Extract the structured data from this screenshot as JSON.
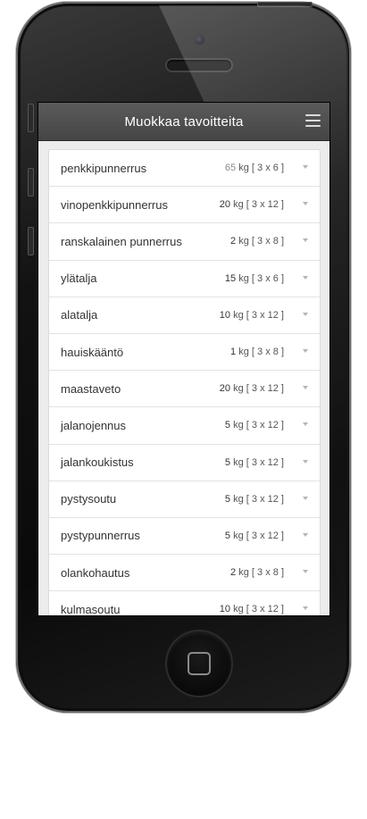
{
  "app": {
    "title": "Muokkaa tavoitteita"
  },
  "icons": {
    "menu": "hamburger-menu-icon",
    "row_arrow": "chevron-down-icon",
    "home": "home-button-square"
  },
  "colors": {
    "navbar": "#4f4f4f",
    "navbar_text": "#ffffff",
    "screen_bg": "#ececec",
    "list_bg": "#ffffff",
    "row_text": "#333333",
    "chevron": "#b5b5b5",
    "phone_body": "#0f0f0f"
  },
  "goals": [
    {
      "name": "penkkipunnerrus",
      "weight": "65",
      "unit": "kg",
      "sets": "[ 3 x 6 ]"
    },
    {
      "name": "vinopenkkipunnerrus",
      "weight": "20",
      "unit": "kg",
      "sets": "[ 3 x 12 ]"
    },
    {
      "name": "ranskalainen punnerrus",
      "weight": "2",
      "unit": "kg",
      "sets": "[ 3 x 8 ]"
    },
    {
      "name": "ylätalja",
      "weight": "15",
      "unit": "kg",
      "sets": "[ 3 x 6 ]"
    },
    {
      "name": "alatalja",
      "weight": "10",
      "unit": "kg",
      "sets": "[ 3 x 12 ]"
    },
    {
      "name": "hauiskääntö",
      "weight": "1",
      "unit": "kg",
      "sets": "[ 3 x 8 ]"
    },
    {
      "name": "maastaveto",
      "weight": "20",
      "unit": "kg",
      "sets": "[ 3 x 12 ]"
    },
    {
      "name": "jalanojennus",
      "weight": "5",
      "unit": "kg",
      "sets": "[ 3 x 12 ]"
    },
    {
      "name": "jalankoukistus",
      "weight": "5",
      "unit": "kg",
      "sets": "[ 3 x 12 ]"
    },
    {
      "name": "pystysoutu",
      "weight": "5",
      "unit": "kg",
      "sets": "[ 3 x 12 ]"
    },
    {
      "name": "pystypunnerrus",
      "weight": "5",
      "unit": "kg",
      "sets": "[ 3 x 12 ]"
    },
    {
      "name": "olankohautus",
      "weight": "2",
      "unit": "kg",
      "sets": "[ 3 x 8 ]"
    },
    {
      "name": "kulmasoutu",
      "weight": "10",
      "unit": "kg",
      "sets": "[ 3 x 12 ]"
    }
  ]
}
